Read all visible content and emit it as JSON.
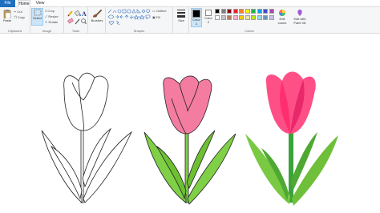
{
  "tabs": {
    "file": "File",
    "home": "Home",
    "view": "View"
  },
  "clipboard": {
    "paste": "Paste",
    "cut": "Cut",
    "copy": "Copy",
    "label": "Clipboard"
  },
  "image": {
    "select": "Select",
    "crop": "Crop",
    "resize": "Resize",
    "rotate": "Rotate",
    "label": "Image"
  },
  "tools": {
    "label": "Tools"
  },
  "brushes": {
    "label": "Brushes"
  },
  "shapes": {
    "outline": "Outline",
    "fill": "Fill",
    "label": "Shapes"
  },
  "size": {
    "label": "Size"
  },
  "colors": {
    "color1": "Color 1",
    "color2": "Color 2",
    "edit": "Edit colors",
    "paint3d": "Edit with Paint 3D",
    "label": "Colors",
    "swatches": [
      "#000000",
      "#7f7f7f",
      "#880015",
      "#ed1c24",
      "#ff7f27",
      "#fff200",
      "#22b14c",
      "#00a2e8",
      "#3f48cc",
      "#a349a4",
      "#ffffff",
      "#c3c3c3",
      "#b97a57",
      "#ffaec9",
      "#ffc90e",
      "#efe4b0",
      "#b5e61d",
      "#99d9ea",
      "#7092be",
      "#c8bfe7"
    ]
  }
}
